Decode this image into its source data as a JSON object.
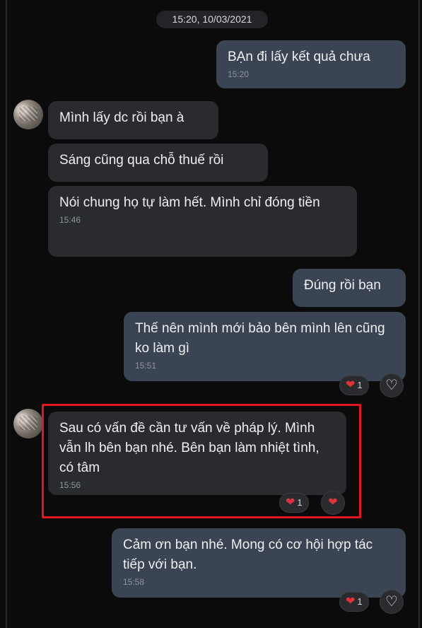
{
  "date_separator": "15:20, 10/03/2021",
  "messages": [
    {
      "side": "out",
      "text": "BẠn đi lấy kết quả chưa",
      "time": "15:20"
    },
    {
      "side": "in",
      "text": "Mình lấy dc rồi bạn à"
    },
    {
      "side": "in",
      "text": "Sáng cũng qua chỗ thuế rồi"
    },
    {
      "side": "in",
      "text": "Nói chung họ tự làm hết. Mình chỉ đóng tiền",
      "time": "15:46"
    },
    {
      "side": "out",
      "text": "Đúng rồi bạn"
    },
    {
      "side": "out",
      "text": "Thế nên mình mới bảo bên mình lên cũng ko làm gì",
      "time": "15:51",
      "reaction_count": "1"
    },
    {
      "side": "in",
      "text": "Sau có vấn đề cần tư vấn về pháp lý. Mình vẫn lh bên bạn nhé. Bên bạn làm nhiệt tình, có tâm",
      "time": "15:56",
      "reaction_count": "1"
    },
    {
      "side": "out",
      "text": "Cảm ơn bạn nhé. Mong có cơ hội hợp tác tiếp với bạn.",
      "time": "15:58",
      "reaction_count": "1"
    }
  ],
  "icons": {
    "reaction": "heart-icon",
    "react_button": "heart-outline-icon"
  },
  "colors": {
    "background": "#0b0b0c",
    "incoming_bubble": "#2a2b2e",
    "outgoing_bubble": "#3a4452",
    "heart": "#e0323c",
    "highlight_border": "#e2171b"
  }
}
